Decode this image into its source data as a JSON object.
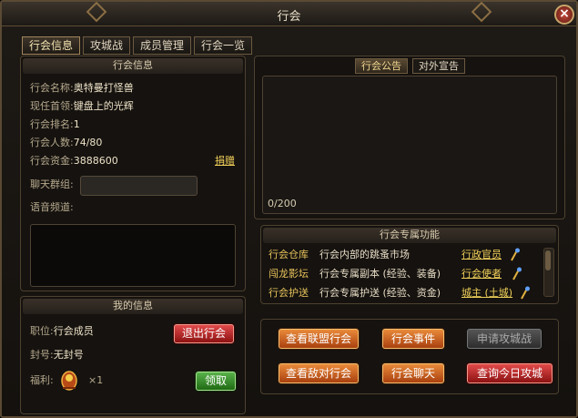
{
  "window": {
    "title": "行会",
    "close": "×"
  },
  "tabs": [
    "行会信息",
    "攻城战",
    "成员管理",
    "行会一览"
  ],
  "guild_info": {
    "header": "行会信息",
    "fields": [
      {
        "label": "行会名称:",
        "value": "奥特曼打怪兽"
      },
      {
        "label": "现任首领:",
        "value": "键盘上的光辉"
      },
      {
        "label": "行会排名:",
        "value": "1"
      },
      {
        "label": "行会人数:",
        "value": "74/80"
      },
      {
        "label": "行会资金:",
        "value": "3888600"
      }
    ],
    "donate_link": "捐赠",
    "chat_group_label": "聊天群组:",
    "voice_channel_label": "语音频道:"
  },
  "my_info": {
    "header": "我的信息",
    "position_label": "职位:",
    "position_value": "行会成员",
    "leave_button": "退出行会",
    "title_label": "封号:",
    "title_value": "无封号",
    "welfare_label": "福利:",
    "welfare_count": "×1",
    "claim_button": "领取"
  },
  "notice": {
    "tabs": [
      "行会公告",
      "对外宣告"
    ],
    "counter": "0/200"
  },
  "functions": {
    "header": "行会专属功能",
    "items": [
      {
        "name": "行会仓库",
        "desc": "行会内部的跳蚤市场",
        "npc": "行政官员"
      },
      {
        "name": "闯龙影坛",
        "desc": "行会专属副本 (经验、装备)",
        "npc": "行会使者"
      },
      {
        "name": "行会护送",
        "desc": "行会专属护送 (经验、资金)",
        "npc": "城主 (土城)"
      }
    ]
  },
  "actions": {
    "view_alliance": "查看联盟行会",
    "guild_events": "行会事件",
    "apply_siege": "申请攻城战",
    "view_enemy": "查看敌对行会",
    "guild_chat": "行会聊天",
    "today_siege": "查询今日攻城"
  }
}
